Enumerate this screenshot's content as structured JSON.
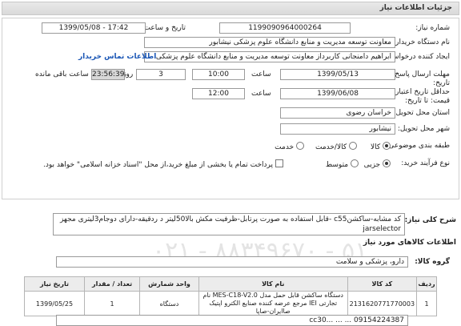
{
  "header": {
    "title": "جزئیات اطلاعات نیاز"
  },
  "form": {
    "need_number_label": "شماره نیاز:",
    "need_number": "1199090964000264",
    "announce_label": "تاریخ و ساعت اعلان عمومی:",
    "announce_value": "1399/05/08 - 17:42",
    "buyer_org_label": "نام دستگاه خریدار:",
    "buyer_org": "معاونت توسعه مدیریت و منابع دانشگاه علوم پزشکی نیشابور",
    "creator_label": "ایجاد کننده درخواست:",
    "creator": "ابراهیم دامنجانی  کاربرداز معاونت توسعه مدیریت و منابع دانشگاه علوم پزشکی",
    "contact_link": "اطلاعات تماس خریدار",
    "reply_deadline_label": "مهلت ارسال پاسخ: تا تاریخ:",
    "reply_date": "1399/05/13",
    "time_label": "ساعت",
    "reply_time": "10:00",
    "days_value": "3",
    "days_label": "روز و",
    "remaining_time": "23:56:39",
    "remaining_label": "ساعت باقی مانده",
    "validity_label": "حداقل تاریخ اعتبار قیمت: تا تاریخ:",
    "validity_date": "1399/06/08",
    "validity_time": "12:00",
    "province_label": "استان محل تحویل:",
    "province": "خراسان رضوی",
    "city_label": "شهر محل تحویل:",
    "city": "نیشابور",
    "category_label": "طبقه بندی موضوعی:",
    "category_options": [
      "کالا",
      "کالا/خدمت",
      "خدمت"
    ],
    "process_label": "نوع فرآیند خرید:",
    "process_options": [
      "جزیی",
      "متوسط"
    ],
    "payment_note": "پرداخت تمام یا بخشی از مبلغ خرید،از محل \"اسناد خزانه اسلامی\" خواهد بود."
  },
  "description": {
    "label": "شرح کلی نیاز:",
    "text": "کد مشابه-ساکشنc55 -قابل استفاده به صورت پرتابل-ظرفیت مکش بالا50لیتر د ردقیقه-دارای دوجام3لیتری مجهز jarselector"
  },
  "goods": {
    "section_title": "اطلاعات کالاهای مورد نیاز",
    "group_label": "گروه کالا:",
    "group_value": "دارو، پزشکی و سلامت",
    "watermark": "۰۲۱ - ۸۸۳۴۹۶۷۰ - ۵۱",
    "columns": [
      "ردیف",
      "کد کالا",
      "نام کالا",
      "واحد شمارش",
      "تعداد / مقدار",
      "تاریخ نیاز"
    ],
    "rows": [
      {
        "index": "1",
        "code": "2131620771770003",
        "name": "دستگاه ساکشن قابل حمل مدل MES-C18-V2.0 نام تجارتی IEI مرجع عرضه کننده صنایع الکترو اپتیک صاایران-صاپا",
        "unit": "دستگاه",
        "qty": "1",
        "date": "1399/05/25"
      }
    ],
    "bottom_text": "cc30... ... ... 09154224387"
  }
}
